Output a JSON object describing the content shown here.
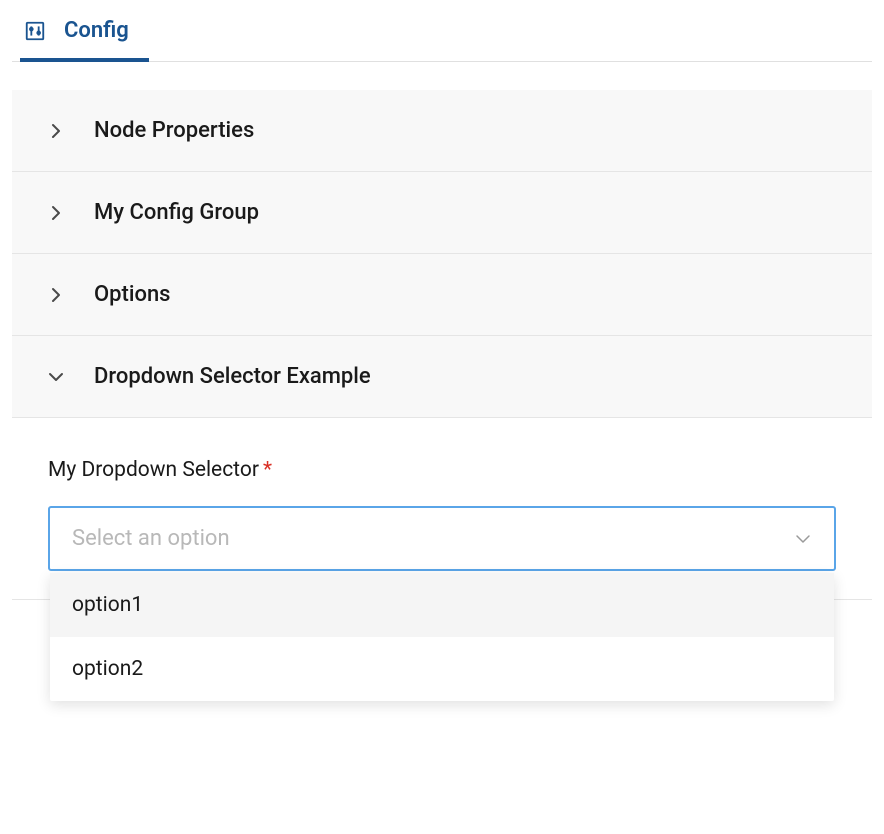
{
  "tab": {
    "label": "Config"
  },
  "sections": {
    "nodeProperties": {
      "label": "Node Properties"
    },
    "myConfigGroup": {
      "label": "My Config Group"
    },
    "options": {
      "label": "Options"
    },
    "dropdownExample": {
      "label": "Dropdown Selector Example"
    }
  },
  "field": {
    "label": "My Dropdown Selector",
    "placeholder": "Select an option",
    "options": [
      {
        "label": "option1"
      },
      {
        "label": "option2"
      }
    ]
  }
}
